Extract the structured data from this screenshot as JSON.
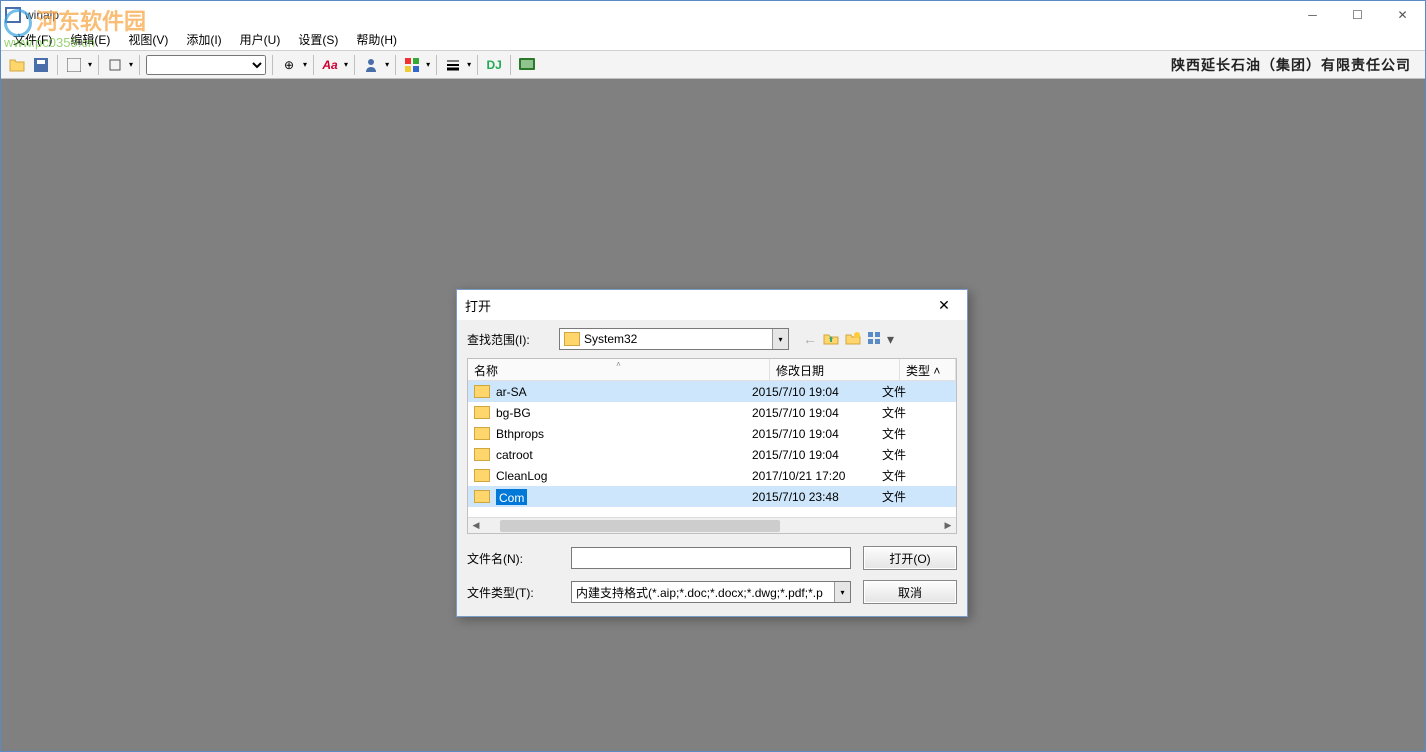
{
  "app": {
    "title": "winaip"
  },
  "watermark": {
    "name": "河东软件园",
    "url": "www.pc0359.cn"
  },
  "menu": {
    "file": "文件(F)",
    "edit": "编辑(E)",
    "view": "视图(V)",
    "add": "添加(I)",
    "user": "用户(U)",
    "settings": "设置(S)",
    "help": "帮助(H)"
  },
  "toolbar": {
    "dj": "DJ",
    "right_text": "陕西延长石油（集团）有限责任公司"
  },
  "dialog": {
    "title": "打开",
    "look_in_label": "查找范围(I):",
    "look_in_value": "System32",
    "columns": {
      "name": "名称",
      "date": "修改日期",
      "type": "类型"
    },
    "rows": [
      {
        "name": "ar-SA",
        "date": "2015/7/10 19:04",
        "type": "文件"
      },
      {
        "name": "bg-BG",
        "date": "2015/7/10 19:04",
        "type": "文件"
      },
      {
        "name": "Bthprops",
        "date": "2015/7/10 19:04",
        "type": "文件"
      },
      {
        "name": "catroot",
        "date": "2015/7/10 19:04",
        "type": "文件"
      },
      {
        "name": "CleanLog",
        "date": "2017/10/21 17:20",
        "type": "文件"
      },
      {
        "name": "Com",
        "date": "2015/7/10 23:48",
        "type": "文件"
      }
    ],
    "filename_label": "文件名(N):",
    "filename_value": "",
    "filetype_label": "文件类型(T):",
    "filetype_value": "内建支持格式(*.aip;*.doc;*.docx;*.dwg;*.pdf;*.p",
    "open_btn": "打开(O)",
    "cancel_btn": "取消"
  }
}
